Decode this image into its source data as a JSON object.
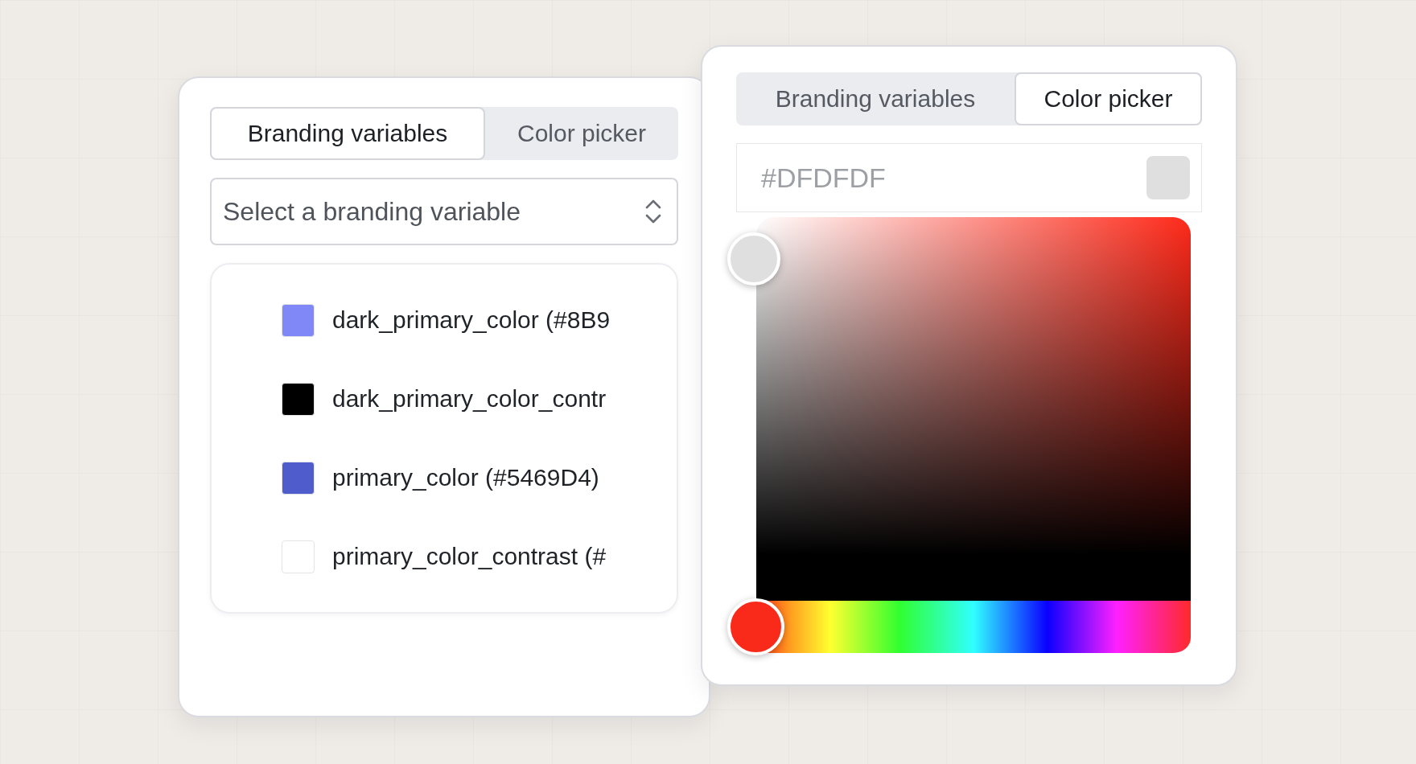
{
  "branding_panel": {
    "tabs": [
      {
        "label": "Branding variables",
        "selected": true
      },
      {
        "label": "Color picker",
        "selected": false
      }
    ],
    "select": {
      "placeholder": "Select a branding variable"
    },
    "variables": [
      {
        "label": "dark_primary_color (#8B9",
        "color": "#8088f8"
      },
      {
        "label": "dark_primary_color_contr",
        "color": "#000000"
      },
      {
        "label": "primary_color (#5469D4)",
        "color": "#4f5ccc"
      },
      {
        "label": "primary_color_contrast (#",
        "color": "#ffffff"
      }
    ]
  },
  "picker_panel": {
    "tabs": [
      {
        "label": "Branding variables",
        "selected": false
      },
      {
        "label": "Color picker",
        "selected": true
      }
    ],
    "hex_field": {
      "value": "#DFDFDF",
      "color": "#dfdfdf"
    },
    "hue_slider": {
      "level": 0
    }
  }
}
